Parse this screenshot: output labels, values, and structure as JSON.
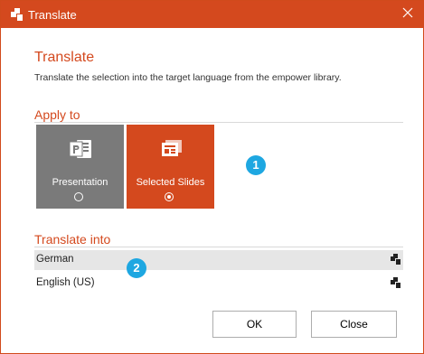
{
  "window": {
    "title": "Translate"
  },
  "header": {
    "title": "Translate",
    "description": "Translate the selection into the target language from the empower library."
  },
  "apply_to": {
    "label": "Apply to",
    "options": [
      {
        "label": "Presentation",
        "selected": false,
        "icon": "powerpoint-icon"
      },
      {
        "label": "Selected Slides",
        "selected": true,
        "icon": "slides-icon"
      }
    ]
  },
  "translate_into": {
    "label": "Translate into",
    "languages": [
      {
        "name": "German",
        "highlighted": true,
        "icon": "empower-library-icon"
      },
      {
        "name": "English (US)",
        "highlighted": false,
        "icon": "empower-library-icon"
      }
    ]
  },
  "badges": [
    "1",
    "2"
  ],
  "buttons": {
    "ok": "OK",
    "close": "Close"
  },
  "colors": {
    "accent": "#d4491e",
    "tile_unselected": "#7a7a7a",
    "badge": "#1ea7e1",
    "highlight_row": "#e6e6e6"
  }
}
